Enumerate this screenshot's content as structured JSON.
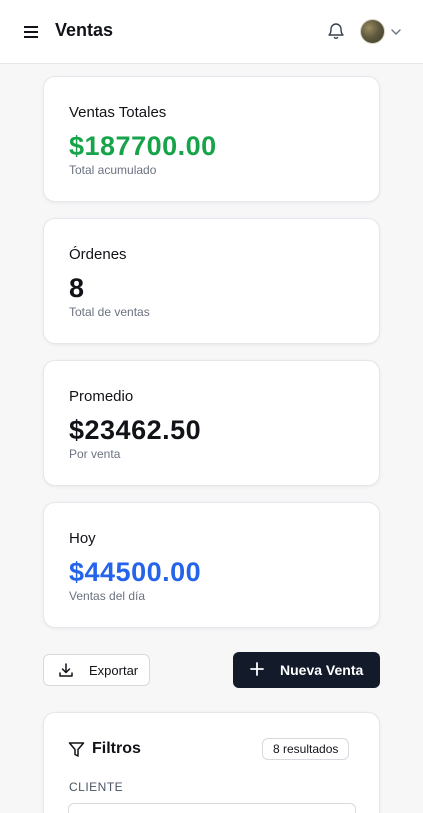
{
  "header": {
    "title": "Ventas",
    "menu_icon": "hamburger-menu-icon",
    "notification_icon": "bell-icon",
    "avatar_icon": "user-avatar",
    "dropdown_icon": "chevron-down-icon"
  },
  "stats": [
    {
      "label": "Ventas Totales",
      "value": "$187700.00",
      "sub": "Total acumulado",
      "color": "#16a34a"
    },
    {
      "label": "Órdenes",
      "value": "8",
      "sub": "Total de ventas",
      "color": "#111318"
    },
    {
      "label": "Promedio",
      "value": "$23462.50",
      "sub": "Por venta",
      "color": "#111318"
    },
    {
      "label": "Hoy",
      "value": "$44500.00",
      "sub": "Ventas del día",
      "color": "#2563eb"
    }
  ],
  "actions": {
    "export_label": "Exportar",
    "export_icon": "download-icon",
    "new_label": "Nueva Venta",
    "new_icon": "plus-icon"
  },
  "filters": {
    "title": "Filtros",
    "icon": "funnel-icon",
    "results_badge": "8 resultados",
    "cliente_label": "CLIENTE",
    "cliente_value": ""
  }
}
